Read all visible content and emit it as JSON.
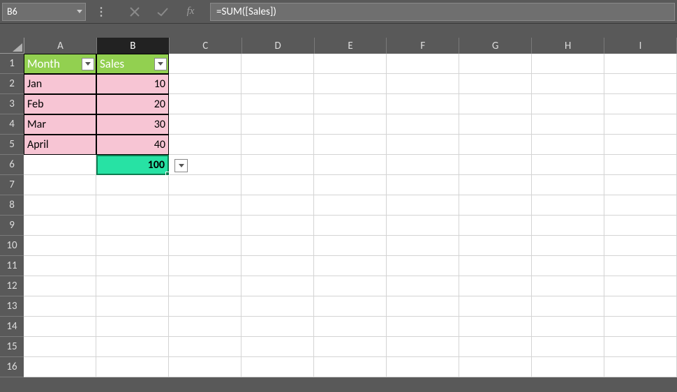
{
  "name_box": "B6",
  "formula": "=SUM([Sales])",
  "columns": [
    "A",
    "B",
    "C",
    "D",
    "E",
    "F",
    "G",
    "H",
    "I"
  ],
  "active_col_index": 1,
  "rows": [
    1,
    2,
    3,
    4,
    5,
    6,
    7,
    8,
    9,
    10,
    11,
    12,
    13,
    14,
    15,
    16
  ],
  "table": {
    "headers": [
      "Month",
      "Sales"
    ],
    "data": [
      {
        "month": "Jan",
        "sales": 10
      },
      {
        "month": "Feb",
        "sales": 20
      },
      {
        "month": "Mar",
        "sales": 30
      },
      {
        "month": "April",
        "sales": 40
      }
    ],
    "total_sales": 100
  },
  "chart_data": {
    "type": "table",
    "title": "",
    "categories": [
      "Jan",
      "Feb",
      "Mar",
      "April"
    ],
    "values": [
      10,
      20,
      30,
      40
    ],
    "xlabel": "Month",
    "ylabel": "Sales",
    "total": 100
  },
  "colors": {
    "header_bg": "#92d050",
    "data_bg": "#f7c5d4",
    "selection_border": "#0d7c50",
    "selection_fill": "#27e2a4"
  },
  "icons": {
    "cancel": "✕",
    "confirm": "✓",
    "fx": "fx"
  }
}
